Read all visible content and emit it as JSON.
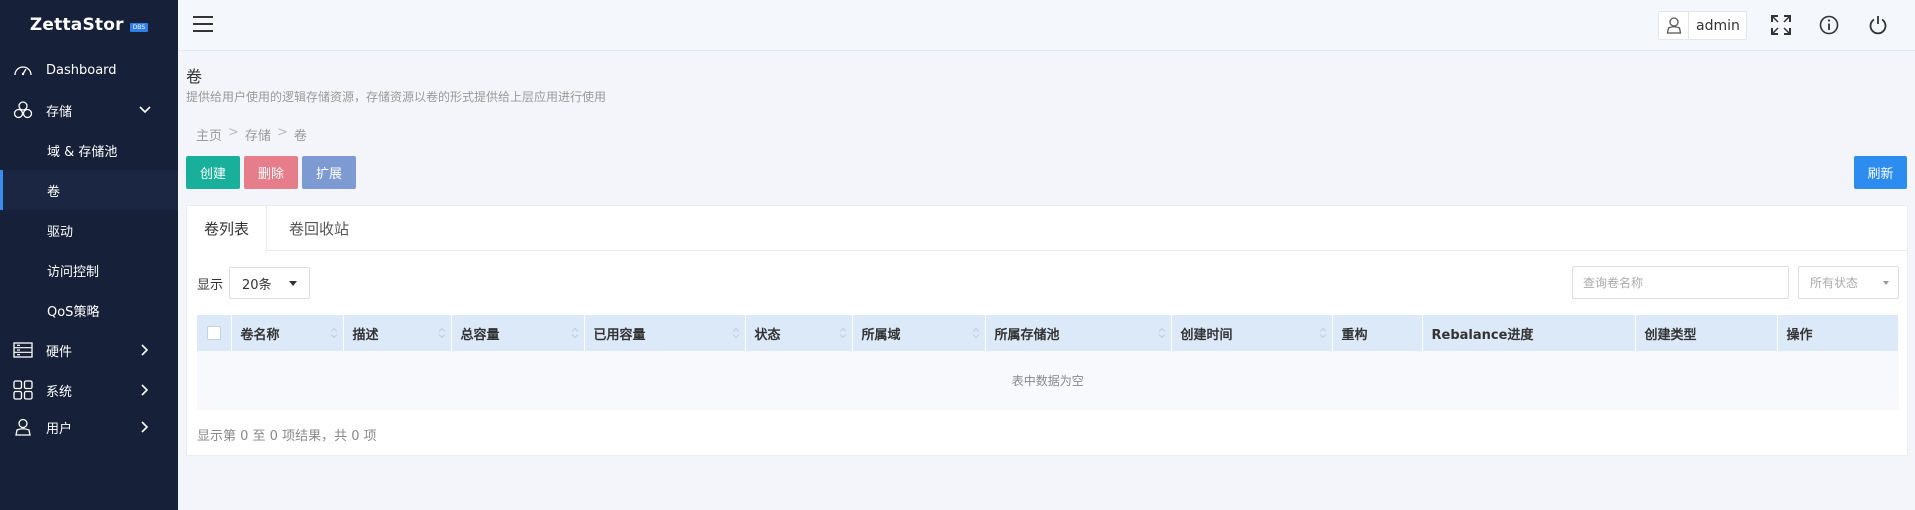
{
  "brand": {
    "name": "ZettaStor",
    "badge": "DBS"
  },
  "sidebar": {
    "items": [
      {
        "label": "Dashboard",
        "icon": "speedometer-icon"
      },
      {
        "label": "存储",
        "icon": "storage-cluster-icon"
      },
      {
        "label": "硬件",
        "icon": "hardware-icon"
      },
      {
        "label": "系统",
        "icon": "grid-system-icon"
      },
      {
        "label": "用户",
        "icon": "user-icon"
      }
    ],
    "storage_sub": [
      {
        "label": "域 & 存储池"
      },
      {
        "label": "卷"
      },
      {
        "label": "驱动"
      },
      {
        "label": "访问控制"
      },
      {
        "label": "QoS策略"
      }
    ]
  },
  "header": {
    "username": "admin"
  },
  "page": {
    "title": "卷",
    "description": "提供给用户使用的逻辑存储资源，存储资源以卷的形式提供给上层应用进行使用",
    "breadcrumb": [
      "主页",
      "存储",
      "卷"
    ],
    "breadcrumb_sep": ">"
  },
  "toolbar": {
    "create": "创建",
    "delete": "删除",
    "expand": "扩展",
    "refresh": "刷新"
  },
  "tabs": [
    {
      "label": "卷列表"
    },
    {
      "label": "卷回收站"
    }
  ],
  "table_controls": {
    "show_label": "显示",
    "page_size": "20条",
    "search_placeholder": "查询卷名称",
    "status_filter": "所有状态"
  },
  "table": {
    "columns": [
      "卷名称",
      "描述",
      "总容量",
      "已用容量",
      "状态",
      "所属域",
      "所属存储池",
      "创建时间",
      "重构",
      "Rebalance进度",
      "创建类型",
      "操作"
    ],
    "empty_text": "表中数据为空",
    "footer": "显示第 0 至 0 项结果，共 0 项"
  },
  "colors": {
    "sidebar_bg": "#162039",
    "create": "#18b09a",
    "delete": "#e57e8a",
    "expand": "#7e9ad2",
    "refresh": "#2d8cf0",
    "header_row": "#dce9f9"
  }
}
